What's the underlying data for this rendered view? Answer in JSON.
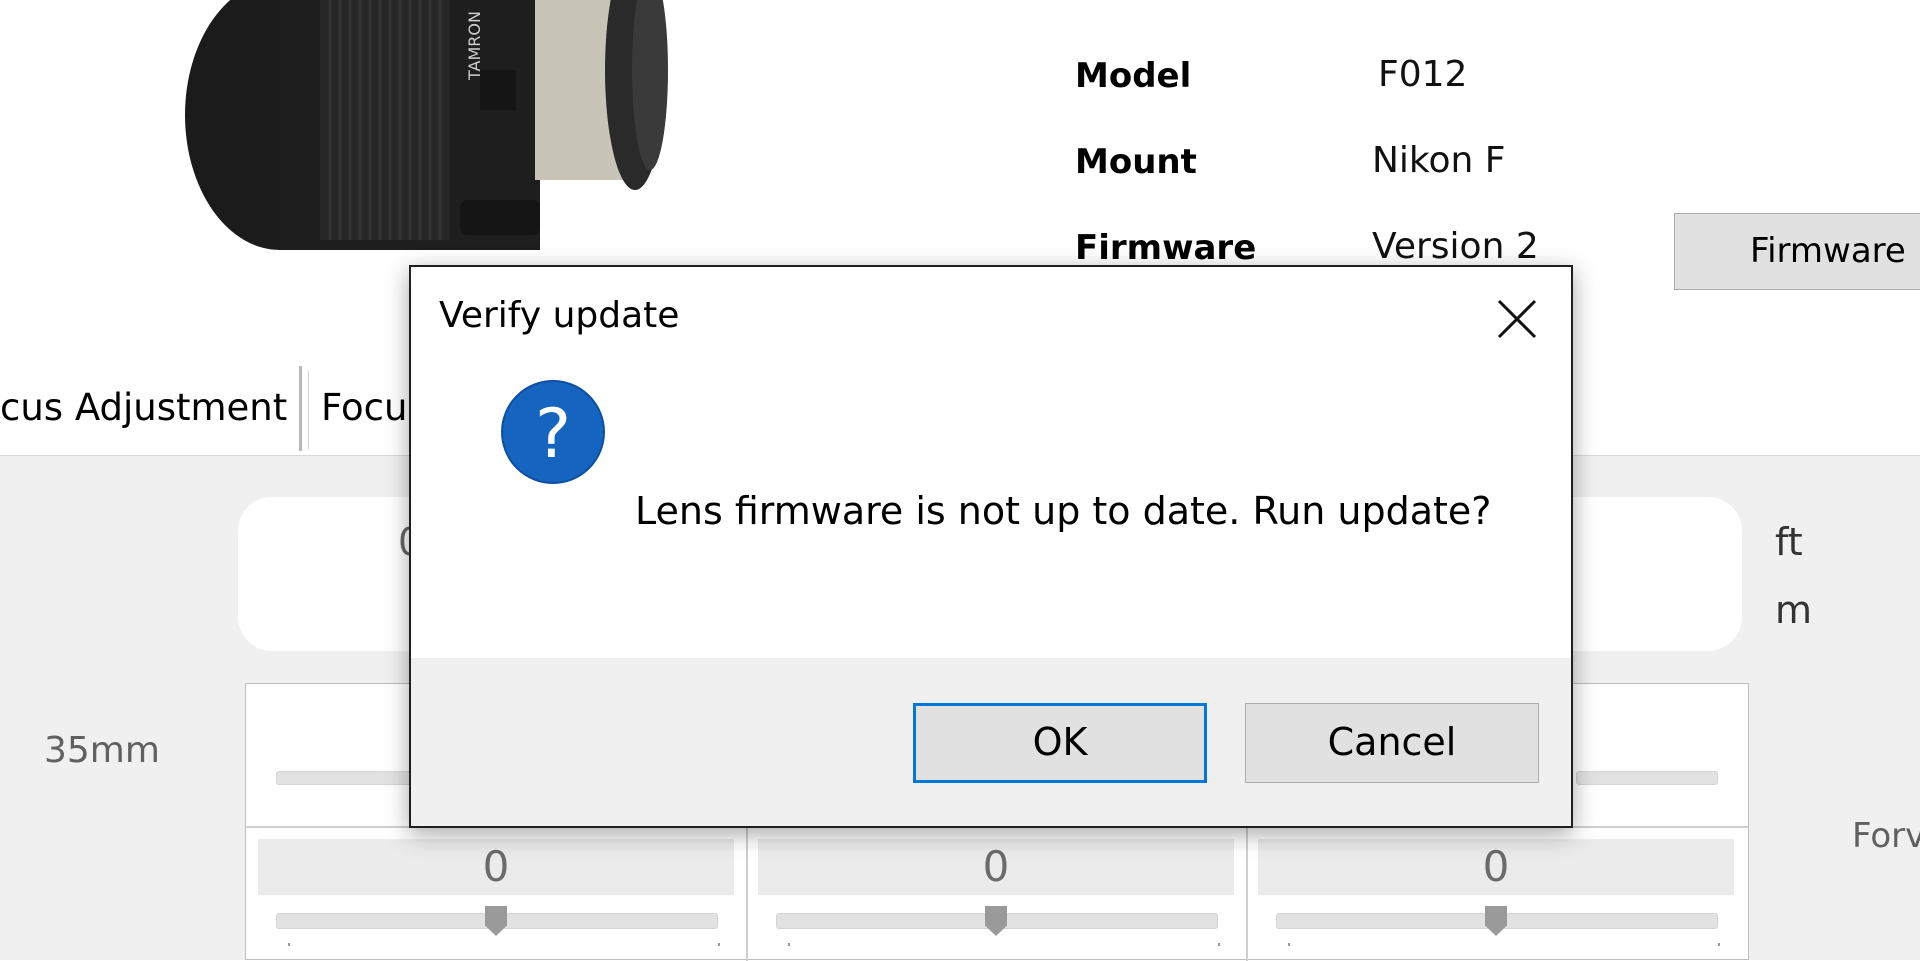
{
  "lens": {
    "brand_text": "TAMRON"
  },
  "info": {
    "model_label": "Model",
    "model_value": "F012",
    "mount_label": "Mount",
    "mount_value": "Nikon F",
    "firmware_label": "Firmware",
    "firmware_value": "Version 2",
    "firmware_button": "Firmware"
  },
  "tabs": [
    {
      "label": "cus Adjustment",
      "active": true
    },
    {
      "label": "Focu",
      "active": false
    }
  ],
  "panel": {
    "readout_partial": "0",
    "unit_ft": "ft",
    "unit_m": "m",
    "distance_label": "35mm",
    "forward_label": "Forv",
    "cells": [
      {
        "value": "0",
        "slider_level": 0.5
      },
      {
        "value": "0",
        "slider_level": 0.5
      },
      {
        "value": "0",
        "slider_level": 0.5
      }
    ]
  },
  "dialog": {
    "title": "Verify update",
    "message": "Lens firmware is not up to date. Run update?",
    "icon": "question-icon",
    "ok_label": "OK",
    "cancel_label": "Cancel"
  },
  "colors": {
    "accent_blue": "#0078d7",
    "icon_blue": "#1565c0",
    "app_background": "#f0f0f0"
  }
}
